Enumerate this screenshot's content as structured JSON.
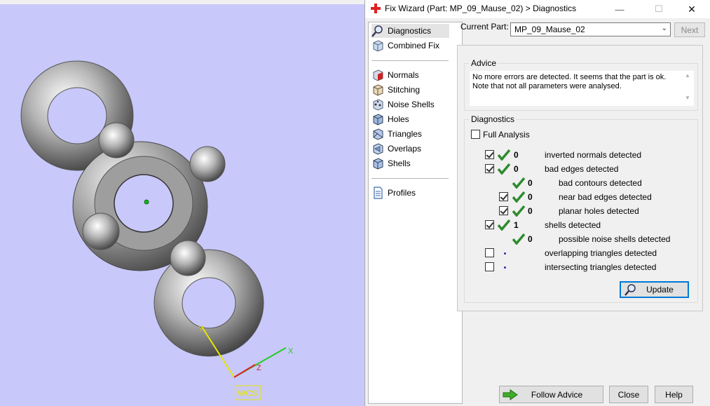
{
  "viewport": {
    "wcs_label": "WCS",
    "axis_x": "X",
    "axis_y": "Y",
    "axis_z": "Z"
  },
  "dialog": {
    "title": "Fix Wizard (Part: MP_09_Mause_02) > Diagnostics",
    "minimize": "—",
    "maximize": "☐",
    "close": "✕",
    "nav": {
      "items_top": [
        {
          "label": "Diagnostics",
          "icon": "magnifier-icon",
          "active": true
        },
        {
          "label": "Combined Fix",
          "icon": "cube-icon"
        }
      ],
      "items_mid": [
        {
          "label": "Normals",
          "icon": "normals-cube-icon"
        },
        {
          "label": "Stitching",
          "icon": "stitching-cube-icon"
        },
        {
          "label": "Noise Shells",
          "icon": "noise-shells-icon"
        },
        {
          "label": "Holes",
          "icon": "holes-cube-icon"
        },
        {
          "label": "Triangles",
          "icon": "triangles-cube-icon"
        },
        {
          "label": "Overlaps",
          "icon": "overlaps-cube-icon"
        },
        {
          "label": "Shells",
          "icon": "shells-cube-icon"
        }
      ],
      "items_bottom": [
        {
          "label": "Profiles",
          "icon": "document-icon"
        }
      ]
    },
    "current_part_label": "Current Part:",
    "current_part_value": "MP_09_Mause_02",
    "next_label": "Next",
    "advice": {
      "title": "Advice",
      "line1": "No more errors are detected. It seems that the part is ok.",
      "line2": "Note that not all parameters were analysed."
    },
    "diagnostics": {
      "title": "Diagnostics",
      "full_analysis_label": "Full Analysis",
      "rows": [
        {
          "checked": true,
          "count": "0",
          "label": "inverted normals detected"
        },
        {
          "checked": true,
          "count": "0",
          "label": "bad edges detected"
        },
        {
          "count": "0",
          "label": "bad contours detected"
        },
        {
          "checked": true,
          "count": "0",
          "label": "near bad edges detected"
        },
        {
          "checked": true,
          "count": "0",
          "label": "planar holes detected"
        },
        {
          "checked": true,
          "count": "1",
          "label": "shells detected"
        },
        {
          "count": "0",
          "label": "possible noise shells detected"
        },
        {
          "checked": false,
          "label": "overlapping triangles detected"
        },
        {
          "checked": false,
          "label": "intersecting triangles detected"
        }
      ],
      "update_label": "Update"
    },
    "buttons": {
      "follow_advice": "Follow Advice",
      "close": "Close",
      "help": "Help"
    },
    "colors": {
      "tick_green": "#2e8b2e",
      "accent_blue": "#0078d7"
    }
  }
}
